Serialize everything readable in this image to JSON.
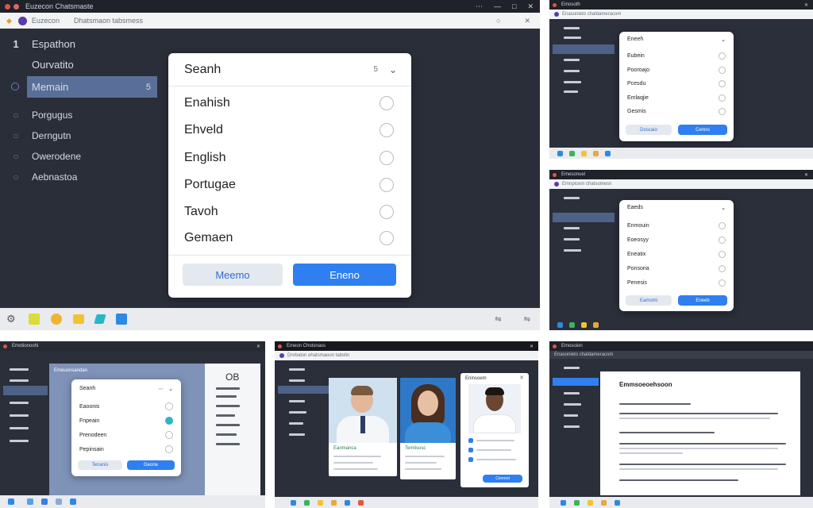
{
  "main": {
    "app_title": "Euzecon Chatsmaste",
    "tab_label": "Euzecon",
    "tab_label_2": "Dhatsmaon tabsmess",
    "sidebar": {
      "items": [
        {
          "number": "1",
          "label": "Espathon"
        },
        {
          "label": "Ourvatito"
        },
        {
          "label": "Memain",
          "badge": "5"
        },
        {
          "label": "Porgugus"
        },
        {
          "label": "Derngutn"
        },
        {
          "label": "Owerodene"
        },
        {
          "label": "Aebnastoa"
        }
      ]
    },
    "dialog": {
      "search_label": "Seanh",
      "count": "5",
      "options": [
        "Enahish",
        "Ehveld",
        "English",
        "Portugae",
        "Tavoh",
        "Gemaen"
      ],
      "selected_index": -1,
      "cancel_label": "Meemo",
      "confirm_label": "Eneno"
    }
  },
  "top_right": {
    "title": "Emosoth",
    "url": "Enasonieto chaldameracom",
    "sidebar_count": 5,
    "dialog": {
      "title": "Eneeh",
      "options": [
        "Eubein",
        "Pooroajo",
        "Pcesdu",
        "Emlaqjie",
        "Gesmis"
      ],
      "cancel_label": "Doscaio",
      "confirm_label": "Cenno"
    }
  },
  "mid_right": {
    "title": "Emesonuel",
    "url": "Emnpicem chatsomesn",
    "dialog": {
      "title": "Eaeds",
      "options": [
        "Enmouin",
        "Eoeosyy",
        "Eneatix",
        "Ponsoria",
        "Penesis"
      ],
      "cancel_label": "Eamomi",
      "confirm_label": "Eneeb"
    }
  },
  "bottom_left": {
    "title": "Emotionoohi",
    "header": "Emeuonsandan",
    "dialog": {
      "title": "Seanh",
      "options": [
        "Eaoonis",
        "Fnpeain",
        "Prenodeen",
        "Pepinsain"
      ],
      "selected_index": 1,
      "cancel_label": "Tenanis",
      "confirm_label": "Geone"
    },
    "right_title": "OB"
  },
  "bottom_mid": {
    "title": "Emeon Chotsnass",
    "url": "Dnrbalon ehatsmaoon tabstin",
    "card1_caption": "Eanmanca",
    "card2_caption": "Temlisosc",
    "chat_title": "Eninsoem",
    "chat_button": "Cenned"
  },
  "bottom_right": {
    "title": "Emosoion",
    "url": "Enasonieto chaldameracom",
    "doc_title": "Emmsoeoehsoon"
  },
  "colors": {
    "accent": "#2f7ff0",
    "sidebar_active": "#5a6f98",
    "dark_bg": "#2b2f3a",
    "titlebar": "#1f2229",
    "taskbar": "#e9ebef"
  },
  "icons": [
    "close-dot-icon",
    "minimize-icon",
    "maximize-icon",
    "close-icon",
    "search-icon",
    "chevron-down-icon",
    "radio-icon",
    "settings-icon",
    "folder-icon",
    "browser-icon",
    "store-icon",
    "app-icon",
    "tray-icon"
  ]
}
